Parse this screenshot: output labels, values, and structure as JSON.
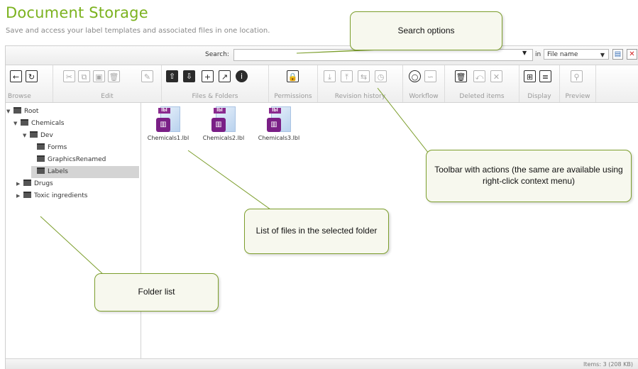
{
  "header": {
    "title": "Document Storage",
    "subtitle": "Save and access your label templates and associated files in one location."
  },
  "search": {
    "label": "Search:",
    "value": "",
    "in_label": "in",
    "field_value": "File name"
  },
  "toolbar": {
    "groups": [
      {
        "label": "Browse"
      },
      {
        "label": "Edit"
      },
      {
        "label": "Files & Folders"
      },
      {
        "label": "Permissions"
      },
      {
        "label": "Revision history"
      },
      {
        "label": "Workflow"
      },
      {
        "label": "Deleted items"
      },
      {
        "label": "Display"
      },
      {
        "label": "Preview"
      }
    ]
  },
  "tree": {
    "items": [
      {
        "label": "Root"
      },
      {
        "label": "Chemicals"
      },
      {
        "label": "Dev"
      },
      {
        "label": "Forms"
      },
      {
        "label": "GraphicsRenamed"
      },
      {
        "label": "Labels"
      },
      {
        "label": "Drugs"
      },
      {
        "label": "Toxic ingredients"
      }
    ]
  },
  "files": [
    {
      "name": "Chemicals1.lbl",
      "tag": "lbl"
    },
    {
      "name": "Chemicals2.lbl",
      "tag": "lbl"
    },
    {
      "name": "Chemicals3.lbl",
      "tag": "lbl"
    }
  ],
  "status": {
    "text": "Items: 3 (208 KB)"
  },
  "callouts": {
    "search_options": "Search options",
    "toolbar": "Toolbar with actions (the same are available using right-click context menu)",
    "file_list": "List of files in the selected folder",
    "folder_list": "Folder list"
  },
  "colors": {
    "title_green": "#7bb21e",
    "callout_border": "#7c9e2c",
    "callout_bg": "#f7f8ee",
    "file_badge": "#7a1f86",
    "selected_row": "#d4d4d4"
  }
}
